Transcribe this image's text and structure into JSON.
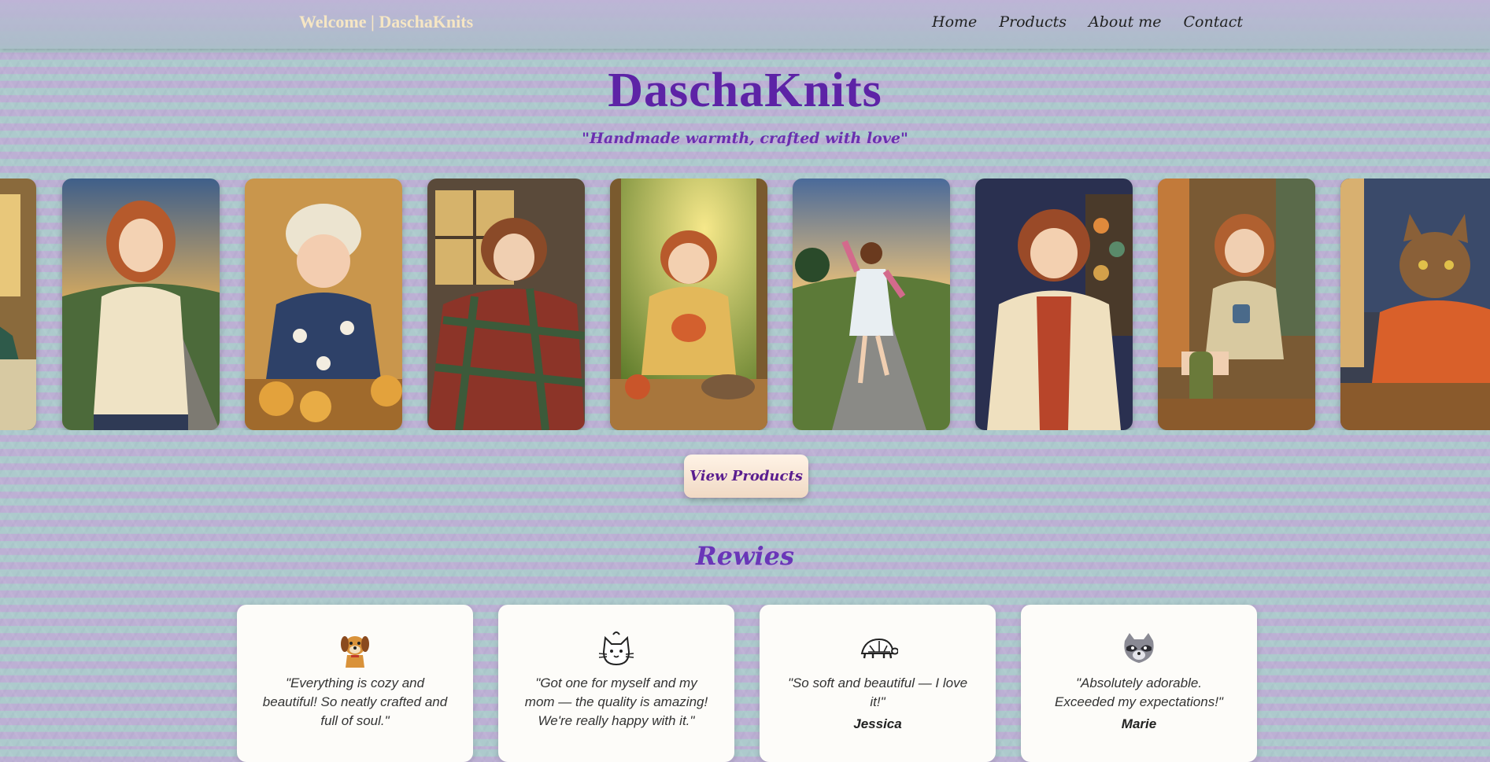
{
  "header": {
    "brand": "Welcome | DaschaKnits",
    "nav": [
      {
        "label": "Home"
      },
      {
        "label": "Products"
      },
      {
        "label": "About me"
      },
      {
        "label": "Contact"
      }
    ]
  },
  "hero": {
    "title": "DaschaKnits",
    "tagline": "\"Handmade warmth, crafted with love\""
  },
  "gallery": {
    "images": [
      {
        "name": "girl-knitting-partial"
      },
      {
        "name": "girl-cream-sweater-sunset"
      },
      {
        "name": "girl-beanie-knitting"
      },
      {
        "name": "girl-plaid-blanket-window"
      },
      {
        "name": "girl-knitting-with-cat"
      },
      {
        "name": "girl-dancing-road"
      },
      {
        "name": "girl-cardigan-shop"
      },
      {
        "name": "girl-with-mug-window"
      },
      {
        "name": "cat-in-sweater-window"
      }
    ]
  },
  "cta": {
    "label": "View Products"
  },
  "reviews": {
    "title": "Rewies",
    "items": [
      {
        "icon": "dog-icon",
        "text": "\"Everything is cozy and beautiful! So neatly crafted and full of soul.\"",
        "author": ""
      },
      {
        "icon": "cat-icon",
        "text": "\"Got one for myself and my mom — the quality is amazing! We're really happy with it.\"",
        "author": ""
      },
      {
        "icon": "turtle-icon",
        "text": "\"So soft and beautiful — I love it!\"",
        "author": "Jessica"
      },
      {
        "icon": "raccoon-icon",
        "text": "\"Absolutely adorable. Exceeded my expectations!\"",
        "author": "Marie"
      }
    ]
  }
}
